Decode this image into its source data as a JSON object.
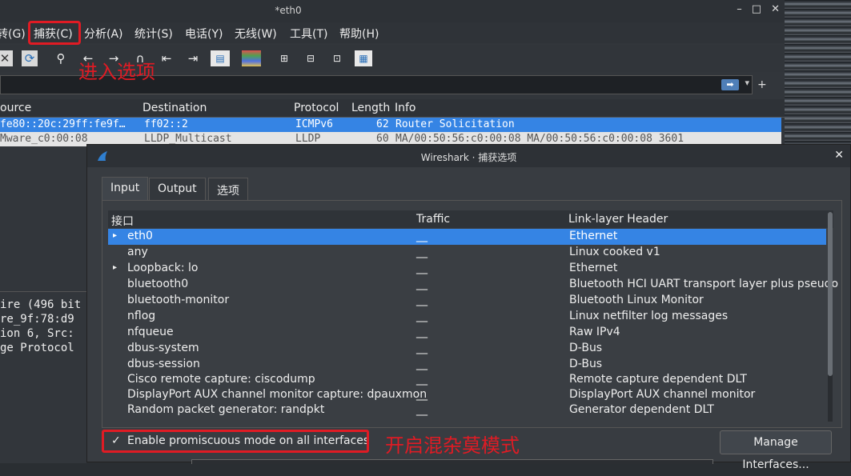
{
  "main": {
    "title": "*eth0",
    "menu": [
      "转(G)",
      "捕获(C)",
      "分析(A)",
      "统计(S)",
      "电话(Y)",
      "无线(W)",
      "工具(T)",
      "帮助(H)"
    ],
    "packet_columns": [
      "ource",
      "Destination",
      "Protocol",
      "Length",
      "Info"
    ],
    "packets": [
      {
        "source": "fe80::20c:29ff:fe9f…",
        "destination": "ff02::2",
        "protocol": "ICMPv6",
        "length": "62",
        "info": "Router Solicitation"
      },
      {
        "source": "Mware_c0:00:08",
        "destination": "LLDP_Multicast",
        "protocol": "LLDP",
        "length": "60",
        "info": "MA/00:50:56:c0:00:08 MA/00:50:56:c0:00:08 3601"
      }
    ],
    "detail_lines": [
      "ire (496 bit",
      "re_9f:78:d9",
      "ion 6, Src:",
      "ge Protocol"
    ]
  },
  "annotations": {
    "menu_note": "进入选项",
    "promisc_note": "开启混杂莫模式",
    "color": "#e01b24"
  },
  "dialog": {
    "title": "Wireshark · 捕获选项",
    "tabs": [
      "Input",
      "Output",
      "选项"
    ],
    "columns": [
      "接口",
      "Traffic",
      "Link-layer Header"
    ],
    "interfaces": [
      {
        "name": "eth0",
        "traffic": "__",
        "header": "Ethernet",
        "expandable": true,
        "selected": true
      },
      {
        "name": "any",
        "traffic": "__",
        "header": "Linux cooked v1",
        "expandable": false,
        "selected": false
      },
      {
        "name": "Loopback: lo",
        "traffic": "__",
        "header": "Ethernet",
        "expandable": true,
        "selected": false
      },
      {
        "name": "bluetooth0",
        "traffic": "__",
        "header": "Bluetooth HCI UART transport layer plus pseudo",
        "expandable": false,
        "selected": false
      },
      {
        "name": "bluetooth-monitor",
        "traffic": "__",
        "header": "Bluetooth Linux Monitor",
        "expandable": false,
        "selected": false
      },
      {
        "name": "nflog",
        "traffic": "__",
        "header": "Linux netfilter log messages",
        "expandable": false,
        "selected": false
      },
      {
        "name": "nfqueue",
        "traffic": "__",
        "header": "Raw IPv4",
        "expandable": false,
        "selected": false
      },
      {
        "name": "dbus-system",
        "traffic": "__",
        "header": "D-Bus",
        "expandable": false,
        "selected": false
      },
      {
        "name": "dbus-session",
        "traffic": "__",
        "header": "D-Bus",
        "expandable": false,
        "selected": false
      },
      {
        "name": "Cisco remote capture: ciscodump",
        "traffic": "__",
        "header": "Remote capture dependent DLT",
        "expandable": false,
        "selected": false
      },
      {
        "name": "DisplayPort AUX channel monitor capture: dpauxmon",
        "traffic": "__",
        "header": "DisplayPort AUX channel monitor",
        "expandable": false,
        "selected": false
      },
      {
        "name": "Random packet generator: randpkt",
        "traffic": "__",
        "header": "Generator dependent DLT",
        "expandable": false,
        "selected": false
      }
    ],
    "promisc_label": "Enable promiscuous mode on all interfaces",
    "promisc_checked": true,
    "manage_label": "Manage Interfaces..."
  }
}
